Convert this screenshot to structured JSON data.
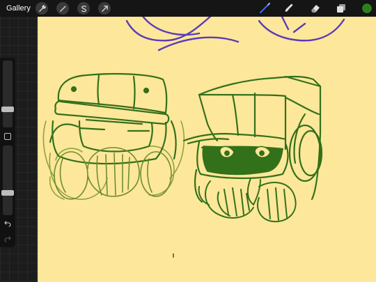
{
  "toolbar": {
    "gallery_label": "Gallery",
    "actions": [
      {
        "name": "actions-wrench-icon"
      },
      {
        "name": "adjustments-wand-icon"
      },
      {
        "name": "selection-s-icon"
      },
      {
        "name": "transform-arrow-icon"
      }
    ],
    "tools": [
      {
        "name": "brush-tool-icon",
        "active": true
      },
      {
        "name": "smudge-tool-icon",
        "active": false
      },
      {
        "name": "eraser-tool-icon",
        "active": false
      },
      {
        "name": "layers-icon",
        "active": false
      }
    ],
    "current_color": "#2e7d1f"
  },
  "sidebar": {
    "brush_size_slider": {
      "level": 0.25
    },
    "opacity_slider": {
      "level": 0.3
    },
    "buttons": [
      "undo-icon",
      "redo-icon"
    ]
  },
  "colors": {
    "canvas": "#fde79a",
    "sketch_green": "#33701a",
    "sketch_light_green": "#8fa33c",
    "sketch_purple": "#5a3cb8",
    "accent_blue": "#3b6ff5"
  }
}
